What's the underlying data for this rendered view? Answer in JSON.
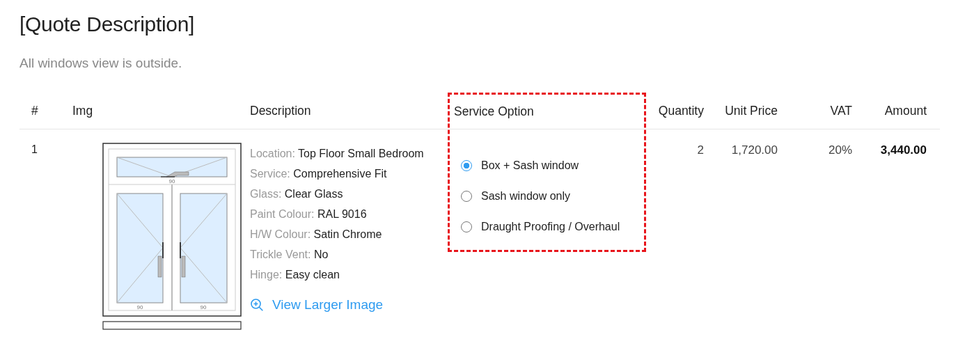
{
  "title": "[Quote Description]",
  "subtitle": "All windows view is outside.",
  "columns": [
    {
      "label": "#",
      "highlighted": false
    },
    {
      "label": "Img",
      "highlighted": false
    },
    {
      "label": "Description",
      "highlighted": false
    },
    {
      "label": "Service Option",
      "highlighted": true
    },
    {
      "label": "Quantity",
      "highlighted": false
    },
    {
      "label": "Unit Price",
      "highlighted": false
    },
    {
      "label": "VAT",
      "highlighted": false
    },
    {
      "label": "Amount",
      "highlighted": false
    }
  ],
  "rows": [
    {
      "number": "1",
      "dimension_labels": [
        "90",
        "90",
        "90"
      ],
      "details": [
        {
          "label": "Location:",
          "value": "Top Floor Small Bedroom"
        },
        {
          "label": "Service:",
          "value": "Comprehensive Fit"
        },
        {
          "label": "Glass:",
          "value": "Clear Glass"
        },
        {
          "label": "Paint Colour:",
          "value": "RAL 9016"
        },
        {
          "label": "H/W Colour:",
          "value": "Satin Chrome"
        },
        {
          "label": "Trickle Vent:",
          "value": "No"
        },
        {
          "label": "Hinge:",
          "value": "Easy clean"
        }
      ],
      "link": "View Larger Image",
      "service_options": [
        {
          "label": "Box + Sash window",
          "selected": true
        },
        {
          "label": "Sash window only",
          "selected": false
        },
        {
          "label": "Draught Proofing / Overhaul",
          "selected": false
        }
      ],
      "quantity": "2",
      "unit_price": "1,720.00",
      "vat": "20%",
      "amount": "3,440.00"
    }
  ]
}
